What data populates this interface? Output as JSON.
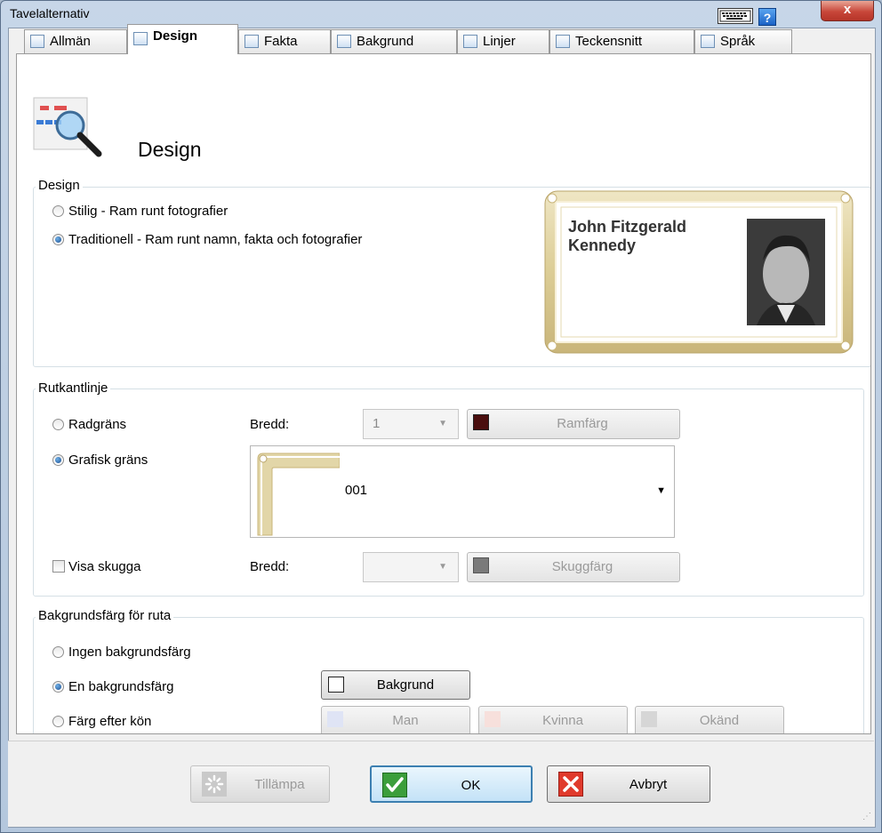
{
  "window": {
    "title": "Tavelalternativ",
    "close_label": "x",
    "help_label": "?"
  },
  "tabs": [
    {
      "label": "Allmän",
      "active": false
    },
    {
      "label": "Design",
      "active": true
    },
    {
      "label": "Fakta",
      "active": false
    },
    {
      "label": "Bakgrund",
      "active": false
    },
    {
      "label": "Linjer",
      "active": false
    },
    {
      "label": "Teckensnitt",
      "active": false
    },
    {
      "label": "Språk",
      "active": false
    }
  ],
  "header": {
    "title": "Design"
  },
  "design_group": {
    "title": "Design",
    "options": [
      {
        "label": "Stilig - Ram runt fotografier",
        "checked": false
      },
      {
        "label": "Traditionell - Ram runt namn, fakta och fotografier",
        "checked": true
      }
    ],
    "preview": {
      "name": "John Fitzgerald Kennedy"
    }
  },
  "border_group": {
    "title": "Rutkantlinje",
    "line_option": "Radgräns",
    "graphic_option": "Grafisk gräns",
    "width_label": "Bredd:",
    "width_value": "1",
    "frame_color_label": "Ramfärg",
    "frame_color": "#4a0e0e",
    "graphic_value": "001",
    "shadow_label": "Visa skugga",
    "shadow_width_label": "Bredd:",
    "shadow_width_value": "",
    "shadow_color_label": "Skuggfärg",
    "shadow_color": "#7a7a7a"
  },
  "bg_group": {
    "title": "Bakgrundsfärg för ruta",
    "none_option": "Ingen bakgrundsfärg",
    "single_option": "En bakgrundsfärg",
    "gender_option": "Färg efter kön",
    "bg_button": "Bakgrund",
    "man_button": "Man",
    "woman_button": "Kvinna",
    "unknown_button": "Okänd",
    "man_color": "#dfe4f5",
    "woman_color": "#f7e0dc",
    "unknown_color": "#d6d6d6"
  },
  "footer": {
    "apply": "Tillämpa",
    "ok": "OK",
    "cancel": "Avbryt"
  }
}
